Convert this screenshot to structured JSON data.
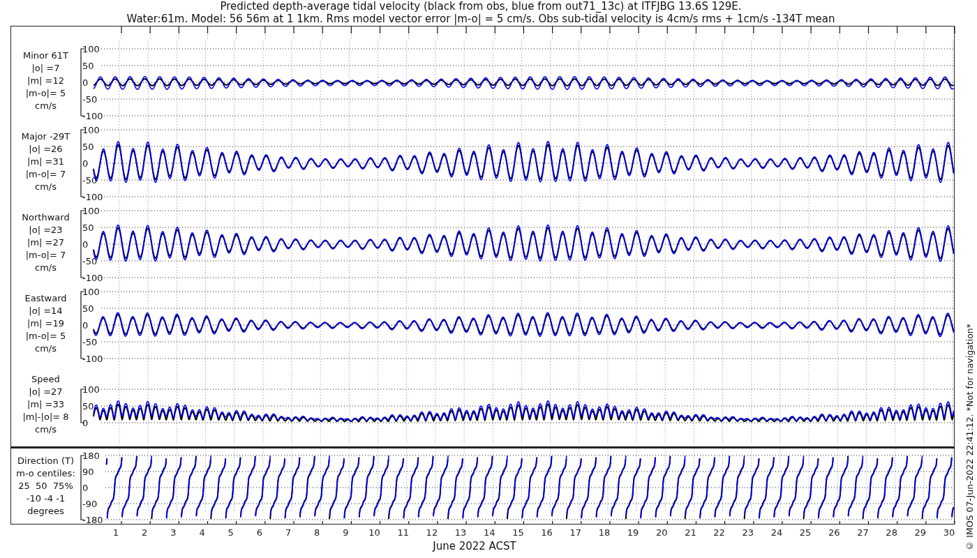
{
  "title": {
    "lines": [
      "Predicted depth-average tidal velocity (black from obs, blue from out71_13c) at ITFJBG 13.6S 129E.",
      "Water:61m. Model: 56 56m at 1 1km. Rms model vector error |m-o| = 5 cm/s. Obs sub-tidal velocity is 4cm/s rms + 1cm/s -134T mean"
    ]
  },
  "panels": [
    {
      "kind": "velocity",
      "label": [
        "Minor 61T",
        "|o| =7",
        "|m| =12",
        "|m-o|= 5",
        "cm/s"
      ],
      "yticks": [
        "100",
        "50",
        "0",
        "-50",
        "-100"
      ]
    },
    {
      "kind": "velocity",
      "label": [
        "Major -29T",
        "|o| =26",
        "|m| =31",
        "|m-o|= 7",
        "cm/s"
      ],
      "yticks": [
        "100",
        "50",
        "0",
        "-50",
        "-100"
      ]
    },
    {
      "kind": "velocity",
      "label": [
        "Northward",
        "|o| =23",
        "|m| =27",
        "|m-o|= 7",
        "cm/s"
      ],
      "yticks": [
        "100",
        "50",
        "0",
        "-50",
        "-100"
      ]
    },
    {
      "kind": "velocity",
      "label": [
        "Eastward",
        "|o| =14",
        "|m| =19",
        "|m-o|= 5",
        "cm/s"
      ],
      "yticks": [
        "100",
        "50",
        "0",
        "-50",
        "-100"
      ]
    },
    {
      "kind": "speed",
      "label": [
        "Speed",
        "|o| =27",
        "|m| =33",
        "|m|-|o|= 8",
        "cm/s"
      ],
      "yticks": [
        "100",
        "50",
        "0"
      ]
    },
    {
      "kind": "direction",
      "label": [
        "Direction (T)",
        "m-o centiles:",
        "25  50  75%",
        "-10 -4 -1",
        "degrees"
      ],
      "yticks": [
        "180",
        "90",
        "0",
        "-90",
        "-180"
      ]
    }
  ],
  "xticks": [
    "1",
    "2",
    "3",
    "4",
    "5",
    "6",
    "7",
    "8",
    "9",
    "10",
    "11",
    "12",
    "13",
    "14",
    "15",
    "16",
    "17",
    "18",
    "19",
    "20",
    "21",
    "22",
    "23",
    "24",
    "25",
    "26",
    "27",
    "28",
    "29",
    "30"
  ],
  "xlabel": "June 2022 ACST",
  "copyright": "© IMOS 07-Jun-2022 22:41:12. *Not for navigation*"
}
